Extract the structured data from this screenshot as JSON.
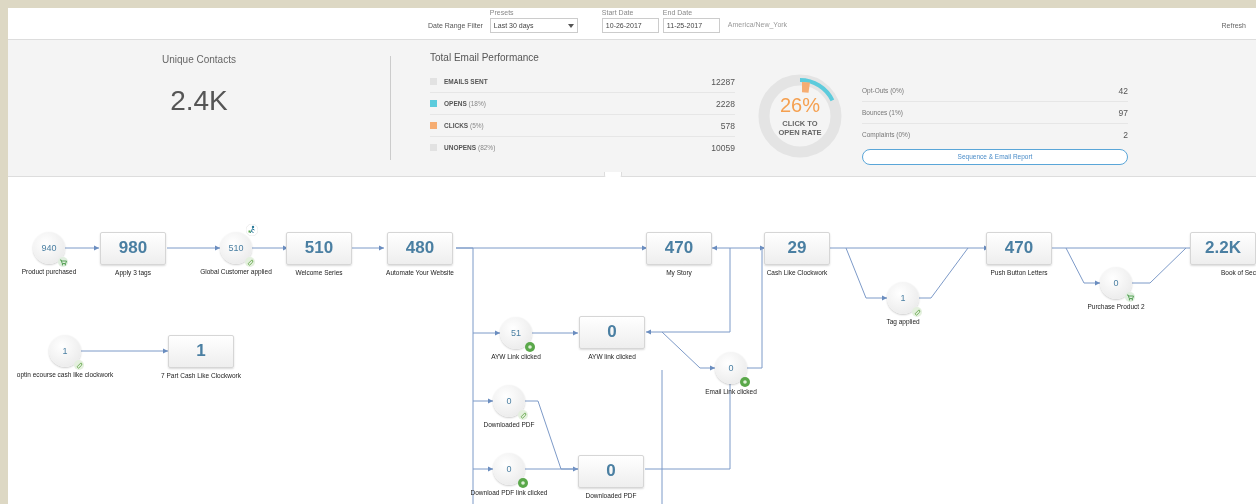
{
  "filter_bar": {
    "label": "Date Range Filter",
    "presets": {
      "label": "Presets",
      "value": "Last 30 days"
    },
    "start_date": {
      "label": "Start Date",
      "value": "10-26-2017"
    },
    "end_date": {
      "label": "End Date",
      "value": "11-25-2017"
    },
    "timezone": "America/New_York",
    "refresh": "Refresh"
  },
  "unique_contacts": {
    "title": "Unique Contacts",
    "value": "2.4K"
  },
  "email_performance": {
    "title": "Total Email Performance",
    "rows": [
      {
        "label": "EMAILS SENT",
        "percent": "",
        "value": "12287",
        "color": "#e2e2e2"
      },
      {
        "label": "OPENS",
        "percent": "(18%)",
        "value": "2228",
        "color": "#5ccbdc"
      },
      {
        "label": "CLICKS",
        "percent": "(5%)",
        "value": "578",
        "color": "#f6ad72"
      },
      {
        "label": "UNOPENS",
        "percent": "(82%)",
        "value": "10059",
        "color": "#e2e2e2"
      }
    ],
    "rate": {
      "value": "26%",
      "caption": "CLICK TO OPEN RATE"
    },
    "stats": [
      {
        "label": "Opt-Outs (0%)",
        "value": "42"
      },
      {
        "label": "Bounces (1%)",
        "value": "97"
      },
      {
        "label": "Complaints (0%)",
        "value": "2"
      }
    ],
    "report_button": "Sequence & Email Report"
  },
  "flow": {
    "nodes": [
      {
        "kind": "event",
        "count": "940",
        "label": "Product purchased"
      },
      {
        "kind": "step",
        "count": "980",
        "label": "Apply 3 tags"
      },
      {
        "kind": "event",
        "count": "510",
        "label": "Global Customer applied"
      },
      {
        "kind": "step",
        "count": "510",
        "label": "Welcome Series"
      },
      {
        "kind": "step",
        "count": "480",
        "label": "Automate Your  Website"
      },
      {
        "kind": "step",
        "count": "470",
        "label": "My Story"
      },
      {
        "kind": "step",
        "count": "29",
        "label": "Cash Like Clockwork"
      },
      {
        "kind": "event",
        "count": "1",
        "label": "Tag applied"
      },
      {
        "kind": "step",
        "count": "470",
        "label": "Push Button Letters"
      },
      {
        "kind": "event",
        "count": "0",
        "label": "Purchase Product 2"
      },
      {
        "kind": "step",
        "count": "2.2K",
        "label": "Book of Sec"
      },
      {
        "kind": "event",
        "count": "1",
        "label": "optin ecourse cash like clockwork"
      },
      {
        "kind": "step",
        "count": "1",
        "label": "7 Part Cash Like Clockwork"
      },
      {
        "kind": "event",
        "count": "51",
        "label": "AYW Link clicked"
      },
      {
        "kind": "step",
        "count": "0",
        "label": "AYW link clicked"
      },
      {
        "kind": "event",
        "count": "0",
        "label": "Email Link clicked"
      },
      {
        "kind": "event",
        "count": "0",
        "label": "Downloaded PDF"
      },
      {
        "kind": "event",
        "count": "0",
        "label": "Download PDF link clicked"
      },
      {
        "kind": "step",
        "count": "0",
        "label": "Downloaded PDF"
      }
    ]
  }
}
